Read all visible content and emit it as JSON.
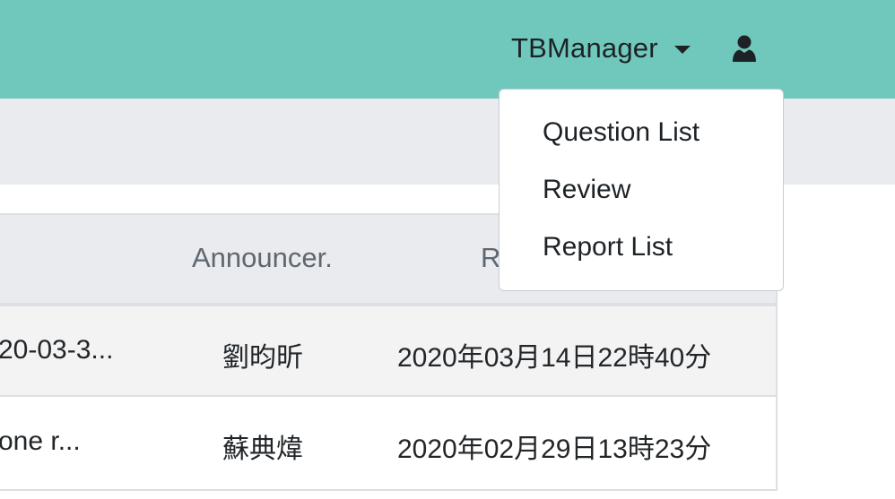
{
  "navbar": {
    "user_menu_label": "TBManager",
    "user_icon": "user-icon"
  },
  "table": {
    "headers": {
      "announcer": "Announcer.",
      "partial_next": "R"
    },
    "rows": [
      {
        "title": "20-03-3...",
        "announcer": "劉昀昕",
        "datetime": "2020年03月14日22時40分"
      },
      {
        "title": "one r...",
        "announcer": "蘇典煒",
        "datetime": "2020年02月29日13時23分"
      }
    ]
  },
  "dropdown": {
    "items": [
      {
        "label": "Question List"
      },
      {
        "label": "Review"
      },
      {
        "label": "Report List"
      }
    ]
  },
  "colors": {
    "navbar": "#70c8bd",
    "subbar": "#e9ebee",
    "table_header": "#e9ebee",
    "row_striped": "#f3f3f4"
  }
}
